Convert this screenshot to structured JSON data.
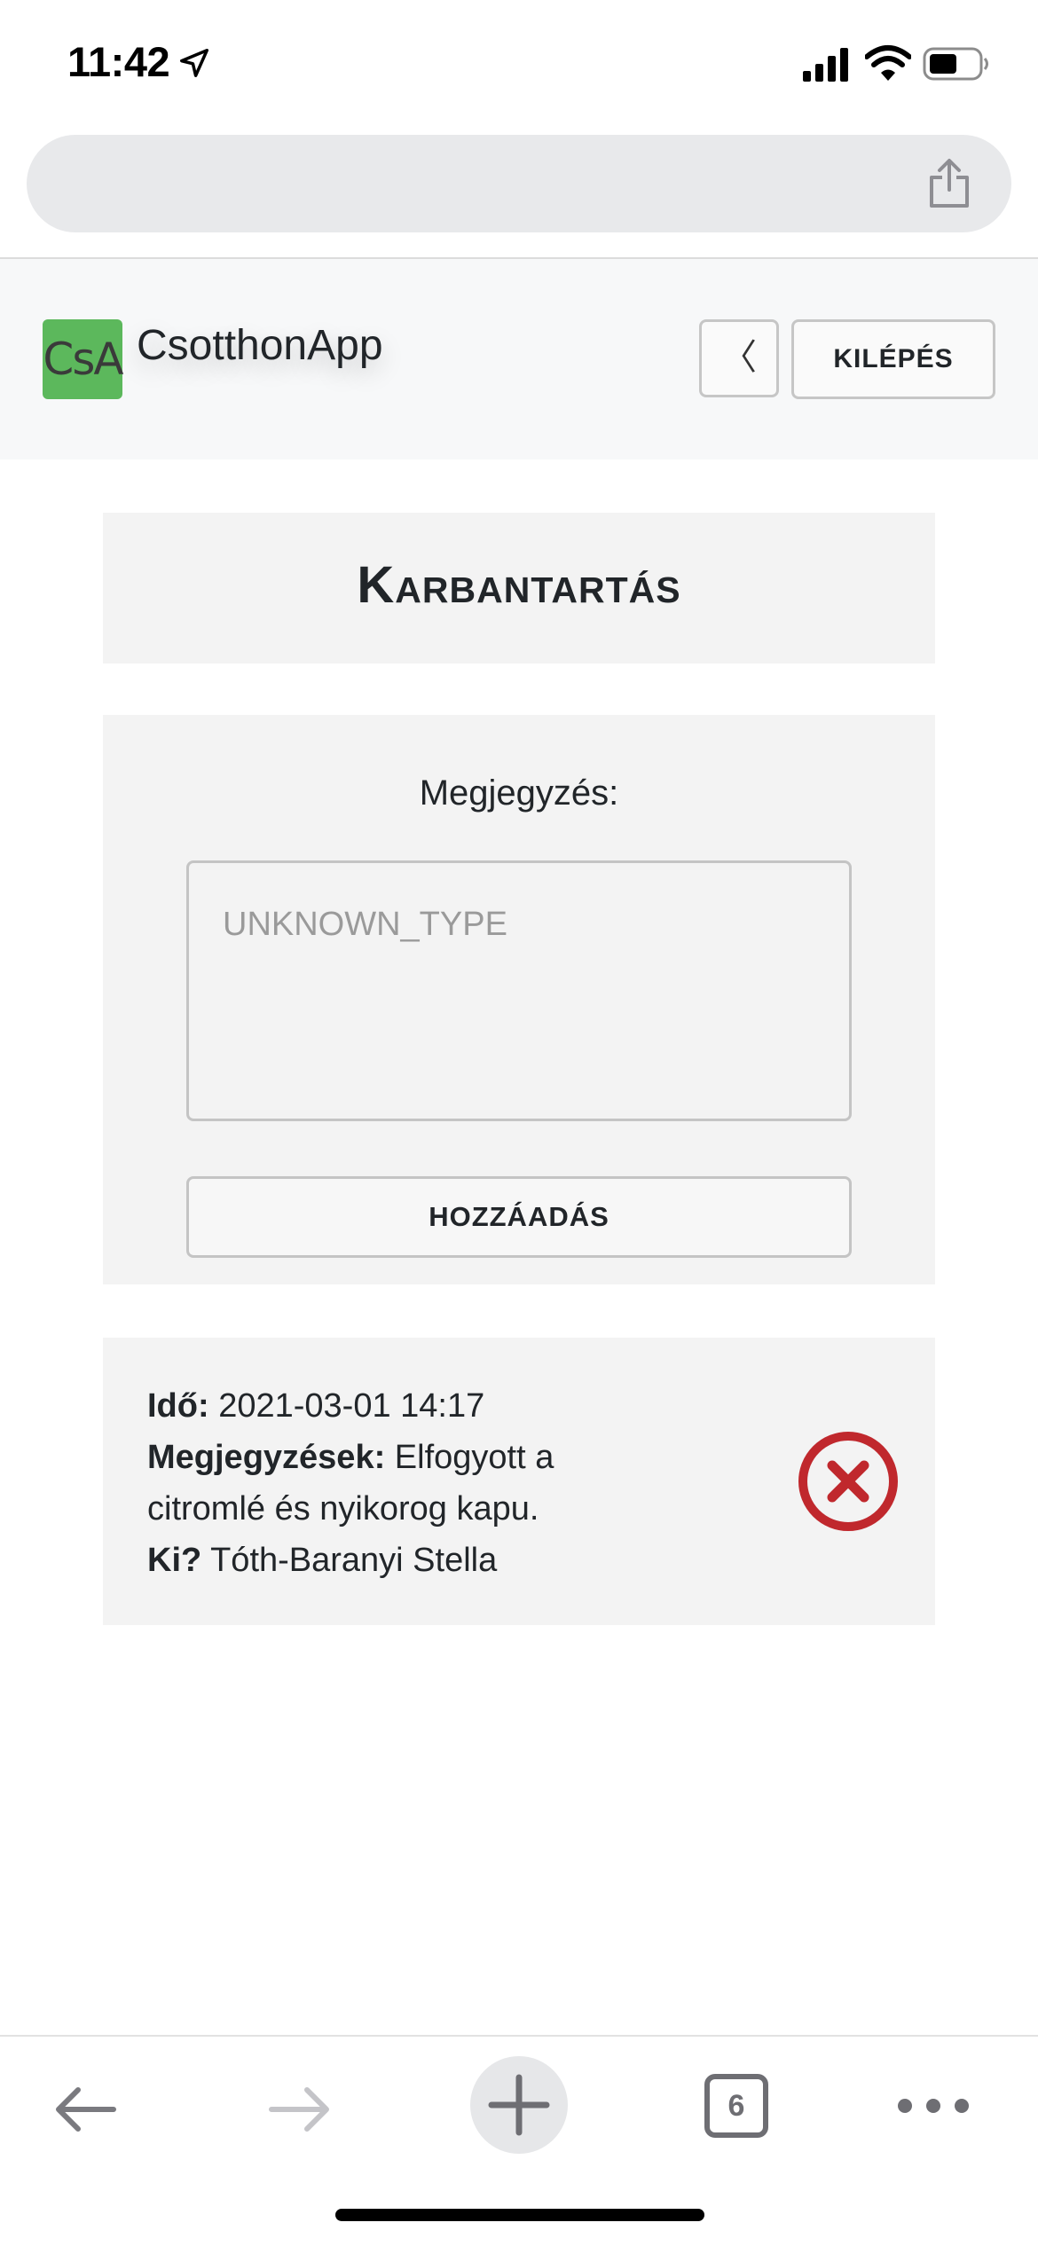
{
  "status_bar": {
    "time": "11:42",
    "icons": [
      "location-arrow-icon",
      "cellular-signal-icon",
      "wifi-icon",
      "battery-icon"
    ]
  },
  "browser": {
    "address_bar_icon": "share-icon",
    "toolbar": {
      "back_icon": "arrow-left-icon",
      "forward_icon": "arrow-right-icon",
      "new_tab_icon": "plus-icon",
      "tab_count": "6",
      "more_icon": "ellipsis-icon"
    }
  },
  "navbar": {
    "logo_text": "CsA",
    "brand_name": "CsotthonApp",
    "back_label": "〈",
    "logout_label": "KILÉPÉS",
    "logo_color": "#5cb85c"
  },
  "main": {
    "title": "Karbantartás",
    "form": {
      "label": "Megjegyzés:",
      "textarea_placeholder": "UNKNOWN_TYPE",
      "textarea_value": "",
      "submit_label": "HOZZÁADÁS"
    },
    "entries": [
      {
        "time_label": "Idő:",
        "time_value": "2021-03-01 14:17",
        "notes_label": "Megjegyzések:",
        "notes_value": "Elfogyott a citromlé és nyikorog kapu.",
        "who_label": "Ki?",
        "who_value": "Tóth-Baranyi Stella",
        "delete_icon": "delete-circle-x-icon",
        "delete_color": "#c0282d"
      }
    ]
  }
}
